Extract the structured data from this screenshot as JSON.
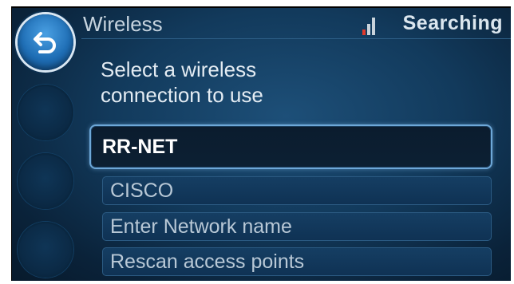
{
  "header": {
    "title": "Wireless",
    "status": "Searching"
  },
  "prompt": {
    "line1": "Select a wireless",
    "line2": "connection to use"
  },
  "networks": [
    {
      "label": "RR-NET",
      "selected": true
    },
    {
      "label": "CISCO",
      "selected": false
    }
  ],
  "actions": [
    {
      "label": "Enter Network name"
    },
    {
      "label": "Rescan access points"
    }
  ],
  "icons": {
    "back": "back-arrow-icon",
    "signal": "signal-strength-icon"
  },
  "colors": {
    "signal_active": "#e0392b",
    "signal_inactive": "#c9d3db"
  }
}
